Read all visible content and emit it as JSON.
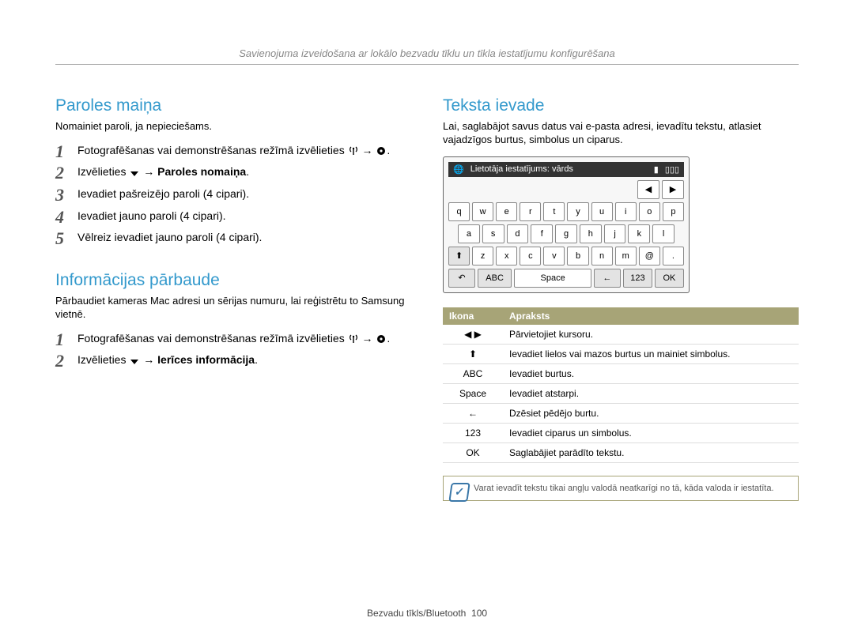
{
  "header": "Savienojuma izveidošana ar lokālo bezvadu tīklu un tīkla iestatījumu konfigurēšana",
  "left": {
    "section1_title": "Paroles maiņa",
    "section1_desc": "Nomainiet paroli, ja nepieciešams.",
    "steps1": {
      "s1": "Fotografēšanas vai demonstrēšanas režīmā izvēlieties",
      "s2_a": "Izvēlieties ",
      "s2_b": " → Paroles nomaiņa",
      "s3": "Ievadiet pašreizējo paroli (4 cipari).",
      "s4": "Ievadiet jauno paroli (4 cipari).",
      "s5": "Vēlreiz ievadiet jauno paroli (4 cipari)."
    },
    "section2_title": "Informācijas pārbaude",
    "section2_desc": "Pārbaudiet kameras Mac adresi un sērijas numuru, lai reģistrētu to Samsung vietnē.",
    "steps2": {
      "s1": "Fotografēšanas vai demonstrēšanas režīmā izvēlieties",
      "s2_a": "Izvēlieties ",
      "s2_b": " → Ierīces informācija"
    }
  },
  "right": {
    "section_title": "Teksta ievade",
    "desc": "Lai, saglabājot savus datus vai e-pasta adresi, ievadītu tekstu, atlasiet vajadzīgos burtus, simbolus un ciparus.",
    "keyboard": {
      "title": "Lietotāja iestatījums: vārds",
      "row1": [
        "q",
        "w",
        "e",
        "r",
        "t",
        "y",
        "u",
        "i",
        "o",
        "p"
      ],
      "row2": [
        "a",
        "s",
        "d",
        "f",
        "g",
        "h",
        "j",
        "k",
        "l"
      ],
      "row3_mid": [
        "z",
        "x",
        "c",
        "v",
        "b",
        "n",
        "m",
        "@",
        "."
      ],
      "bottom": {
        "abc": "ABC",
        "space": "Space",
        "num": "123",
        "ok": "OK"
      }
    },
    "table": {
      "head_icon": "Ikona",
      "head_desc": "Apraksts",
      "rows": [
        {
          "icon": "◀ ▶",
          "desc": "Pārvietojiet kursoru."
        },
        {
          "icon": "⬆",
          "desc": "Ievadiet lielos vai mazos burtus un mainiet simbolus."
        },
        {
          "icon": "ABC",
          "desc": "Ievadiet burtus."
        },
        {
          "icon": "Space",
          "desc": "Ievadiet atstarpi."
        },
        {
          "icon": "←",
          "desc": "Dzēsiet pēdējo burtu."
        },
        {
          "icon": "123",
          "desc": "Ievadiet ciparus un simbolus."
        },
        {
          "icon": "OK",
          "desc": "Saglabājiet parādīto tekstu."
        }
      ]
    },
    "note": "Varat ievadīt tekstu tikai angļu valodā neatkarīgi no tā, kāda valoda ir iestatīta."
  },
  "footer": {
    "text": "Bezvadu tīkls/Bluetooth",
    "page": "100"
  }
}
